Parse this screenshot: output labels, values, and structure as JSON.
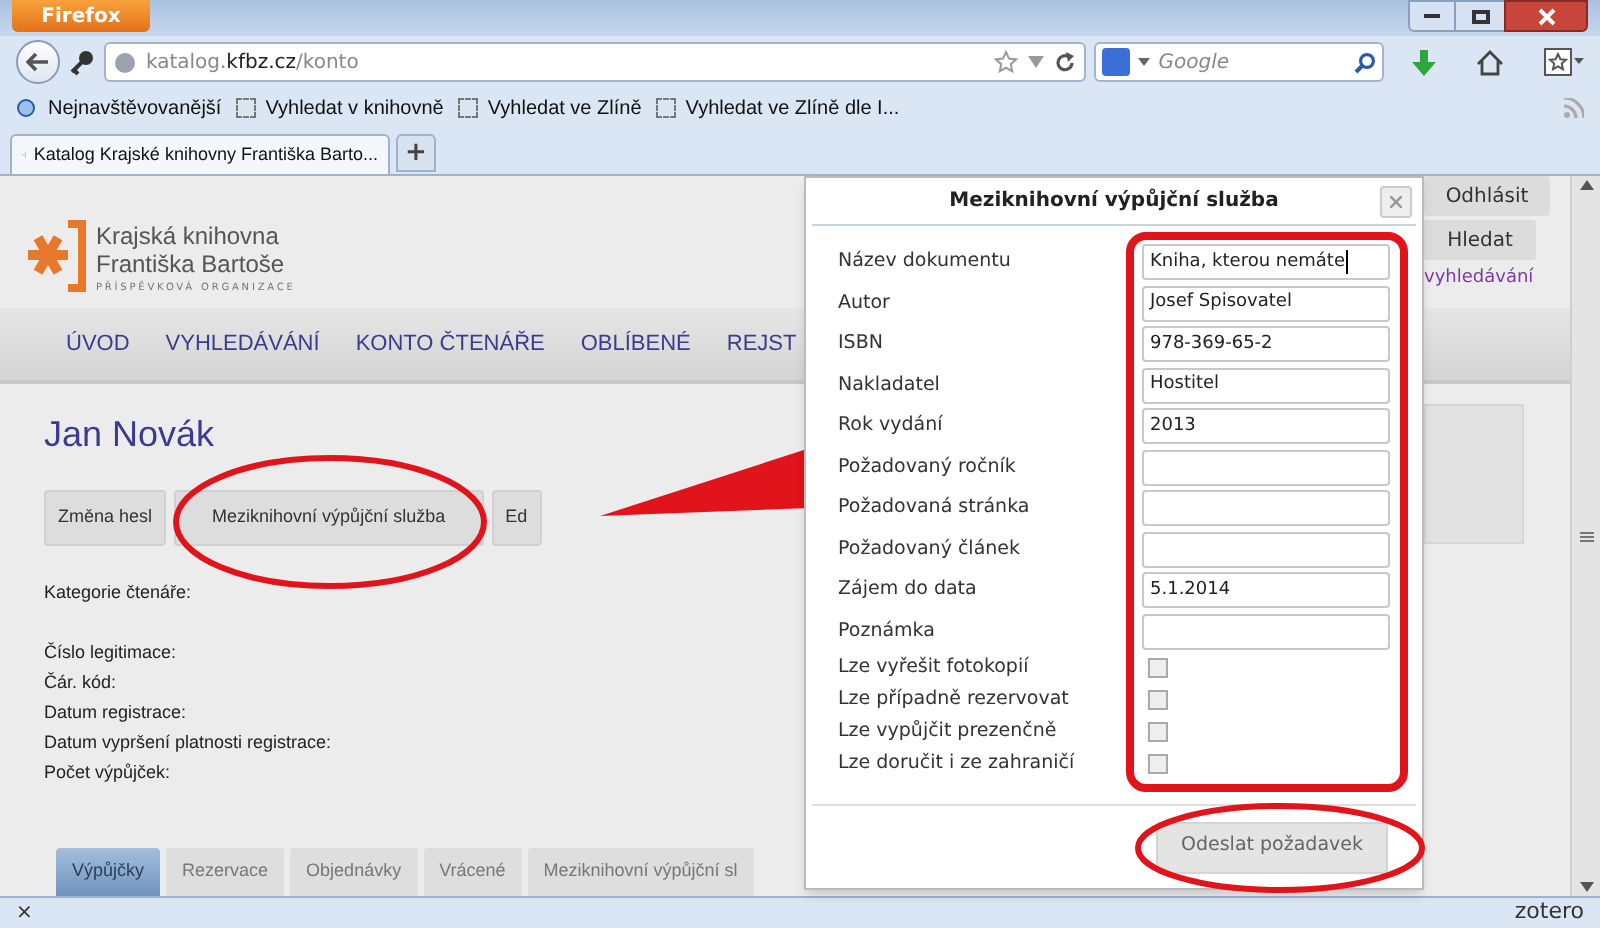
{
  "browser": {
    "app_button": "Firefox",
    "url": {
      "prefix": "katalog.",
      "domain": "kfbz.cz",
      "path": "/konto"
    },
    "search_placeholder": "Google",
    "bookmarks": [
      {
        "kind": "folder",
        "label": "Nejnavštěvovanější"
      },
      {
        "kind": "page",
        "label": "Vyhledat v knihovně"
      },
      {
        "kind": "page",
        "label": "Vyhledat ve Zlíně"
      },
      {
        "kind": "page",
        "label": "Vyhledat ve Zlíně dle I..."
      }
    ],
    "tabs": [
      {
        "title": "Katalog Krajské knihovny Františka Barto...",
        "selected": true
      }
    ],
    "new_tab": "+"
  },
  "page": {
    "logo": {
      "line1": "Krajská knihovna",
      "line2": "Františka Bartoše",
      "tagline": "PŘÍSPĚVKOVÁ ORGANIZACE"
    },
    "header_buttons": [
      "Odhlásit",
      "Hledat"
    ],
    "header_link": "vyhledávání",
    "nav": [
      "ÚVOD",
      "VYHLEDÁVÁNÍ",
      "KONTO ČTENÁŘE",
      "OBLÍBENÉ",
      "REJST"
    ],
    "user_name": "Jan Novák",
    "action_buttons": [
      "Změna hesl",
      "Meziknihovní výpůjční služba",
      "Ed"
    ],
    "info_labels": [
      "Kategorie čtenáře:",
      "Číslo legitimace:",
      "Čár. kód:",
      "Datum registrace:",
      "Datum vypršení platnosti registrace:",
      "Počet výpůjček:"
    ],
    "tabs": [
      {
        "label": "Výpůjčky",
        "selected": true
      },
      {
        "label": "Rezervace",
        "selected": false
      },
      {
        "label": "Objednávky",
        "selected": false
      },
      {
        "label": "Vrácené",
        "selected": false
      },
      {
        "label": "Meziknihovní výpůjční sl",
        "selected": false
      }
    ]
  },
  "dialog": {
    "title": "Meziknihovní výpůjční služba",
    "fields": [
      {
        "kind": "text",
        "label": "Název dokumentu",
        "value": "Kniha, kterou nemáte"
      },
      {
        "kind": "text",
        "label": "Autor",
        "value": "Josef Spisovatel"
      },
      {
        "kind": "text",
        "label": "ISBN",
        "value": "978-369-65-2"
      },
      {
        "kind": "text",
        "label": "Nakladatel",
        "value": "Hostitel"
      },
      {
        "kind": "text",
        "label": "Rok vydání",
        "value": "2013"
      },
      {
        "kind": "text",
        "label": "Požadovaný ročník"
      },
      {
        "kind": "text",
        "label": "Požadovaná stránka"
      },
      {
        "kind": "text",
        "label": "Požadovaný článek"
      },
      {
        "kind": "text",
        "label": "Zájem do data",
        "value": "5.1.2014"
      },
      {
        "kind": "text",
        "label": "Poznámka"
      },
      {
        "kind": "checkbox",
        "label": "Lze vyřešit fotokopií",
        "checked": false
      },
      {
        "kind": "checkbox",
        "label": "Lze případně rezervovat",
        "checked": false
      },
      {
        "kind": "checkbox",
        "label": "Lze vypůjčit prezenčně",
        "checked": false
      },
      {
        "kind": "checkbox",
        "label": "Lze doručit i ze zahraničí",
        "checked": false
      }
    ],
    "submit": "Odeslat požadavek"
  },
  "status_bar": {
    "close": "×",
    "addon": "zotero"
  }
}
